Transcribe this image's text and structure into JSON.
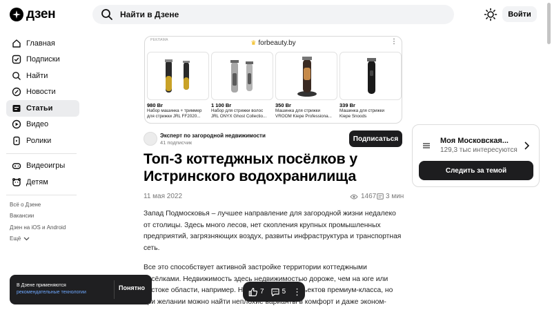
{
  "header": {
    "logo_text": "дзен",
    "search_placeholder": "Найти в Дзене",
    "login_label": "Войти"
  },
  "sidebar": {
    "items": [
      {
        "label": "Главная",
        "icon": "home-icon"
      },
      {
        "label": "Подписки",
        "icon": "subscriptions-icon"
      },
      {
        "label": "Найти",
        "icon": "search-icon"
      },
      {
        "label": "Новости",
        "icon": "news-icon"
      },
      {
        "label": "Статьи",
        "icon": "articles-icon",
        "active": true
      },
      {
        "label": "Видео",
        "icon": "video-icon"
      },
      {
        "label": "Ролики",
        "icon": "clips-icon"
      }
    ],
    "extra_items": [
      {
        "label": "Видеоигры",
        "icon": "gamepad-icon"
      },
      {
        "label": "Детям",
        "icon": "kids-icon"
      }
    ],
    "links": [
      "Всё о Дзене",
      "Вакансии",
      "Дзен на iOS и Android",
      "Ещё"
    ]
  },
  "ad": {
    "label": "РЕКЛАМА",
    "source": "forbeauty.by",
    "products": [
      {
        "price": "980 Br",
        "name1": "Набор машинка + триммер",
        "name2": "для стрижки JRL FF2020..."
      },
      {
        "price": "1 100 Br",
        "name1": "Набор для стрижки волос",
        "name2": "JRL ONYX Ghost Collectio..."
      },
      {
        "price": "350 Br",
        "name1": "Машинка для стрижки",
        "name2": "VROOM Kiepe Professiona..."
      },
      {
        "price": "339 Br",
        "name1": "Машинка для стрижки",
        "name2": "Kiepe Snoods"
      }
    ]
  },
  "author": {
    "name": "Эксперт по загородной недвижимости",
    "subscribers": "41 подписчик",
    "subscribe_label": "Подписаться"
  },
  "article": {
    "title": "Топ-3 коттеджных посёлков у Истринского водохранилища",
    "date": "11 мая 2022",
    "views": "1467",
    "read_time": "3 мин",
    "p1": "Запад Подмосковья – лучшее направление для загородной жизни недалеко от столицы. Здесь много лесов, нет скопления крупных промышленных предприятий, загрязняющих воздух, развиты инфраструктура и транспортная сеть.",
    "p2": "Все это способствует активной застройке территории коттеджными посёлками. Недвижимость здесь недвижимостью дороже, чем на юге или востоке области, например. На западе много объектов премиум-класса, но при желании можно найти неплохие варианты в комфорт и даже эконом-сегменте."
  },
  "topic_card": {
    "title": "Моя Московская...",
    "subtitle": "129,3 тыс интересуются",
    "button": "Следить за темой"
  },
  "cookie_toast": {
    "line1": "В Дзене применяются",
    "link": "рекомендательные технологии",
    "button": "Понятно"
  },
  "action_bar": {
    "likes": "7",
    "comments": "5"
  }
}
